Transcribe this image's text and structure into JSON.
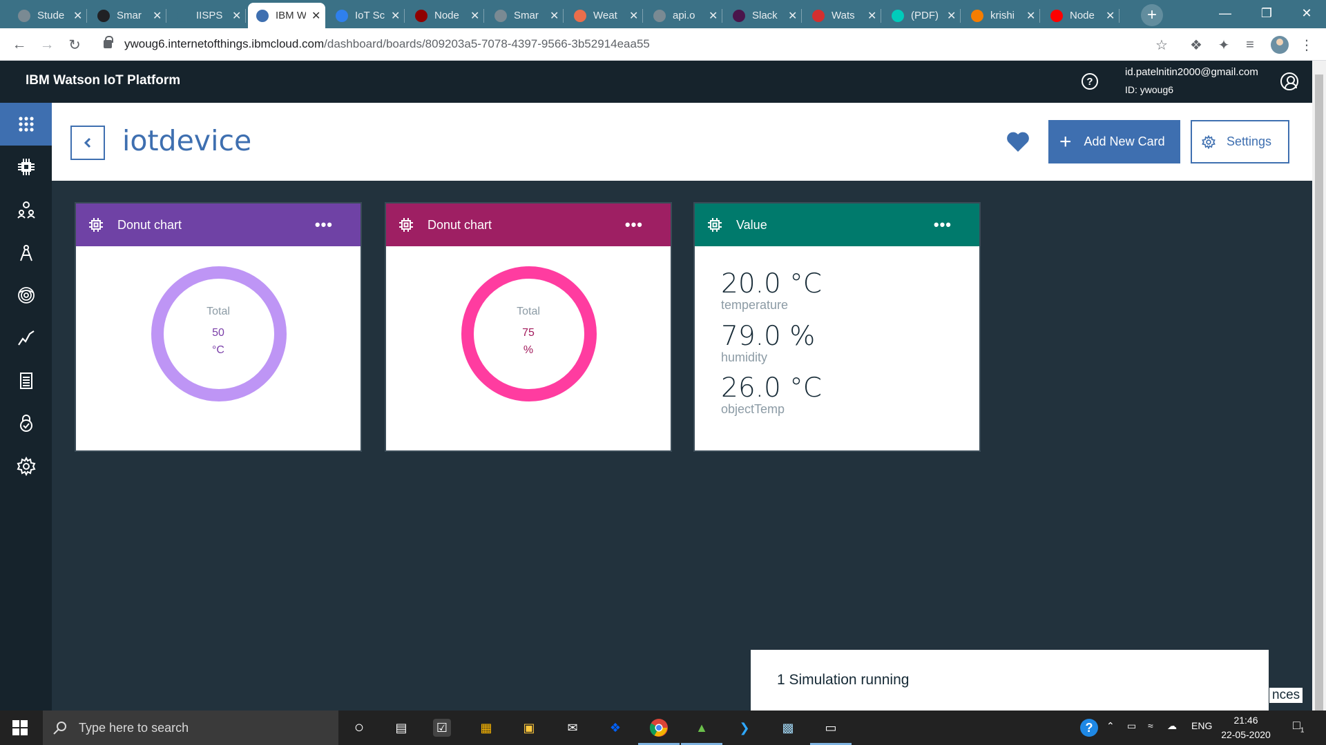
{
  "browser": {
    "tabs": [
      {
        "title": "Stude",
        "fav_color": "#7a8a93",
        "active": false
      },
      {
        "title": "Smar",
        "fav_color": "#202124",
        "active": false
      },
      {
        "title": "IISPS",
        "fav_color": "#3b7186",
        "active": false
      },
      {
        "title": "IBM W",
        "fav_color": "#3e6fb0",
        "active": true
      },
      {
        "title": "IoT Sc",
        "fav_color": "#2f80ed",
        "active": false
      },
      {
        "title": "Node",
        "fav_color": "#8f0000",
        "active": false
      },
      {
        "title": "Smar",
        "fav_color": "#7a8a93",
        "active": false
      },
      {
        "title": "Weat",
        "fav_color": "#eb6e4b",
        "active": false
      },
      {
        "title": "api.o",
        "fav_color": "#7a8a93",
        "active": false
      },
      {
        "title": "Slack",
        "fav_color": "#4a154b",
        "active": false
      },
      {
        "title": "Wats",
        "fav_color": "#d32f2f",
        "active": false
      },
      {
        "title": "(PDF)",
        "fav_color": "#00ccbb",
        "active": false
      },
      {
        "title": "krishi",
        "fav_color": "#f57d00",
        "active": false
      },
      {
        "title": "Node",
        "fav_color": "#ff0000",
        "active": false
      }
    ],
    "url_host": "ywoug6.internetofthings.ibmcloud.com",
    "url_path": "/dashboard/boards/809203a5-7078-4397-9566-3b52914eaa55"
  },
  "header": {
    "brand": "IBM Watson IoT Platform",
    "email": "id.patelnitin2000@gmail.com",
    "org_id": "ID: ywoug6"
  },
  "sidenav": {
    "items": [
      "boards-icon",
      "devices-icon",
      "members-icon",
      "apps-icon",
      "rules-icon",
      "analytics-icon",
      "logs-icon",
      "security-icon",
      "settings-icon"
    ]
  },
  "board": {
    "title": "iotdevice",
    "add_card_label": "Add New Card",
    "settings_label": "Settings"
  },
  "cards": [
    {
      "title": "Donut chart",
      "head_color": "#6f42a5",
      "ring_color": "#be95f5",
      "total_label": "Total",
      "value": "50",
      "unit": "°C",
      "text_color": "#7a3ea8"
    },
    {
      "title": "Donut chart",
      "head_color": "#9e1f63",
      "ring_color": "#ff3ca0",
      "total_label": "Total",
      "value": "75",
      "unit": "%",
      "text_color": "#a2195b"
    },
    {
      "title": "Value",
      "head_color": "#007a6c",
      "rows": [
        {
          "value": "20.0 °C",
          "name": "temperature"
        },
        {
          "value": "79.0 %",
          "name": "humidity"
        },
        {
          "value": "26.0 °C",
          "name": "objectTemp"
        }
      ]
    }
  ],
  "simulation": {
    "status": "1 Simulation running",
    "partial_text": "nces"
  },
  "taskbar": {
    "search_placeholder": "Type here to search",
    "language": "ENG",
    "time": "21:46",
    "date": "22-05-2020",
    "notifications": "1"
  }
}
